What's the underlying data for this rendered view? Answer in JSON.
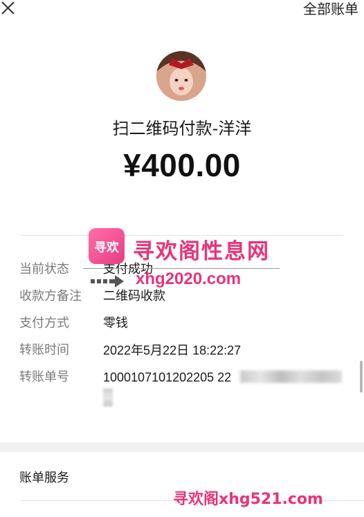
{
  "header": {
    "right_label": "全部账单"
  },
  "payment": {
    "payee_title": "扫二维码付款-洋洋",
    "amount": "¥400.00"
  },
  "details": [
    {
      "label": "当前状态",
      "value": "支付成功"
    },
    {
      "label": "收款方备注",
      "value": "二维码收款"
    },
    {
      "label": "支付方式",
      "value": "零钱"
    },
    {
      "label": "转账时间",
      "value": "2022年5月22日 18:22:27"
    },
    {
      "label": "转账单号",
      "value": "1000107101202205 22"
    }
  ],
  "services": {
    "title": "账单服务"
  },
  "watermark": {
    "title": "寻欢阁性息网",
    "url": "xhg2020.com",
    "bottom_text": "寻欢阁xhg521.com",
    "logo_char": "寻欢"
  },
  "icons": {
    "close": "close-icon",
    "arrow": "arrow-right-icon"
  },
  "colors": {
    "watermark": "#e8337a",
    "label": "#7a7a7a"
  }
}
